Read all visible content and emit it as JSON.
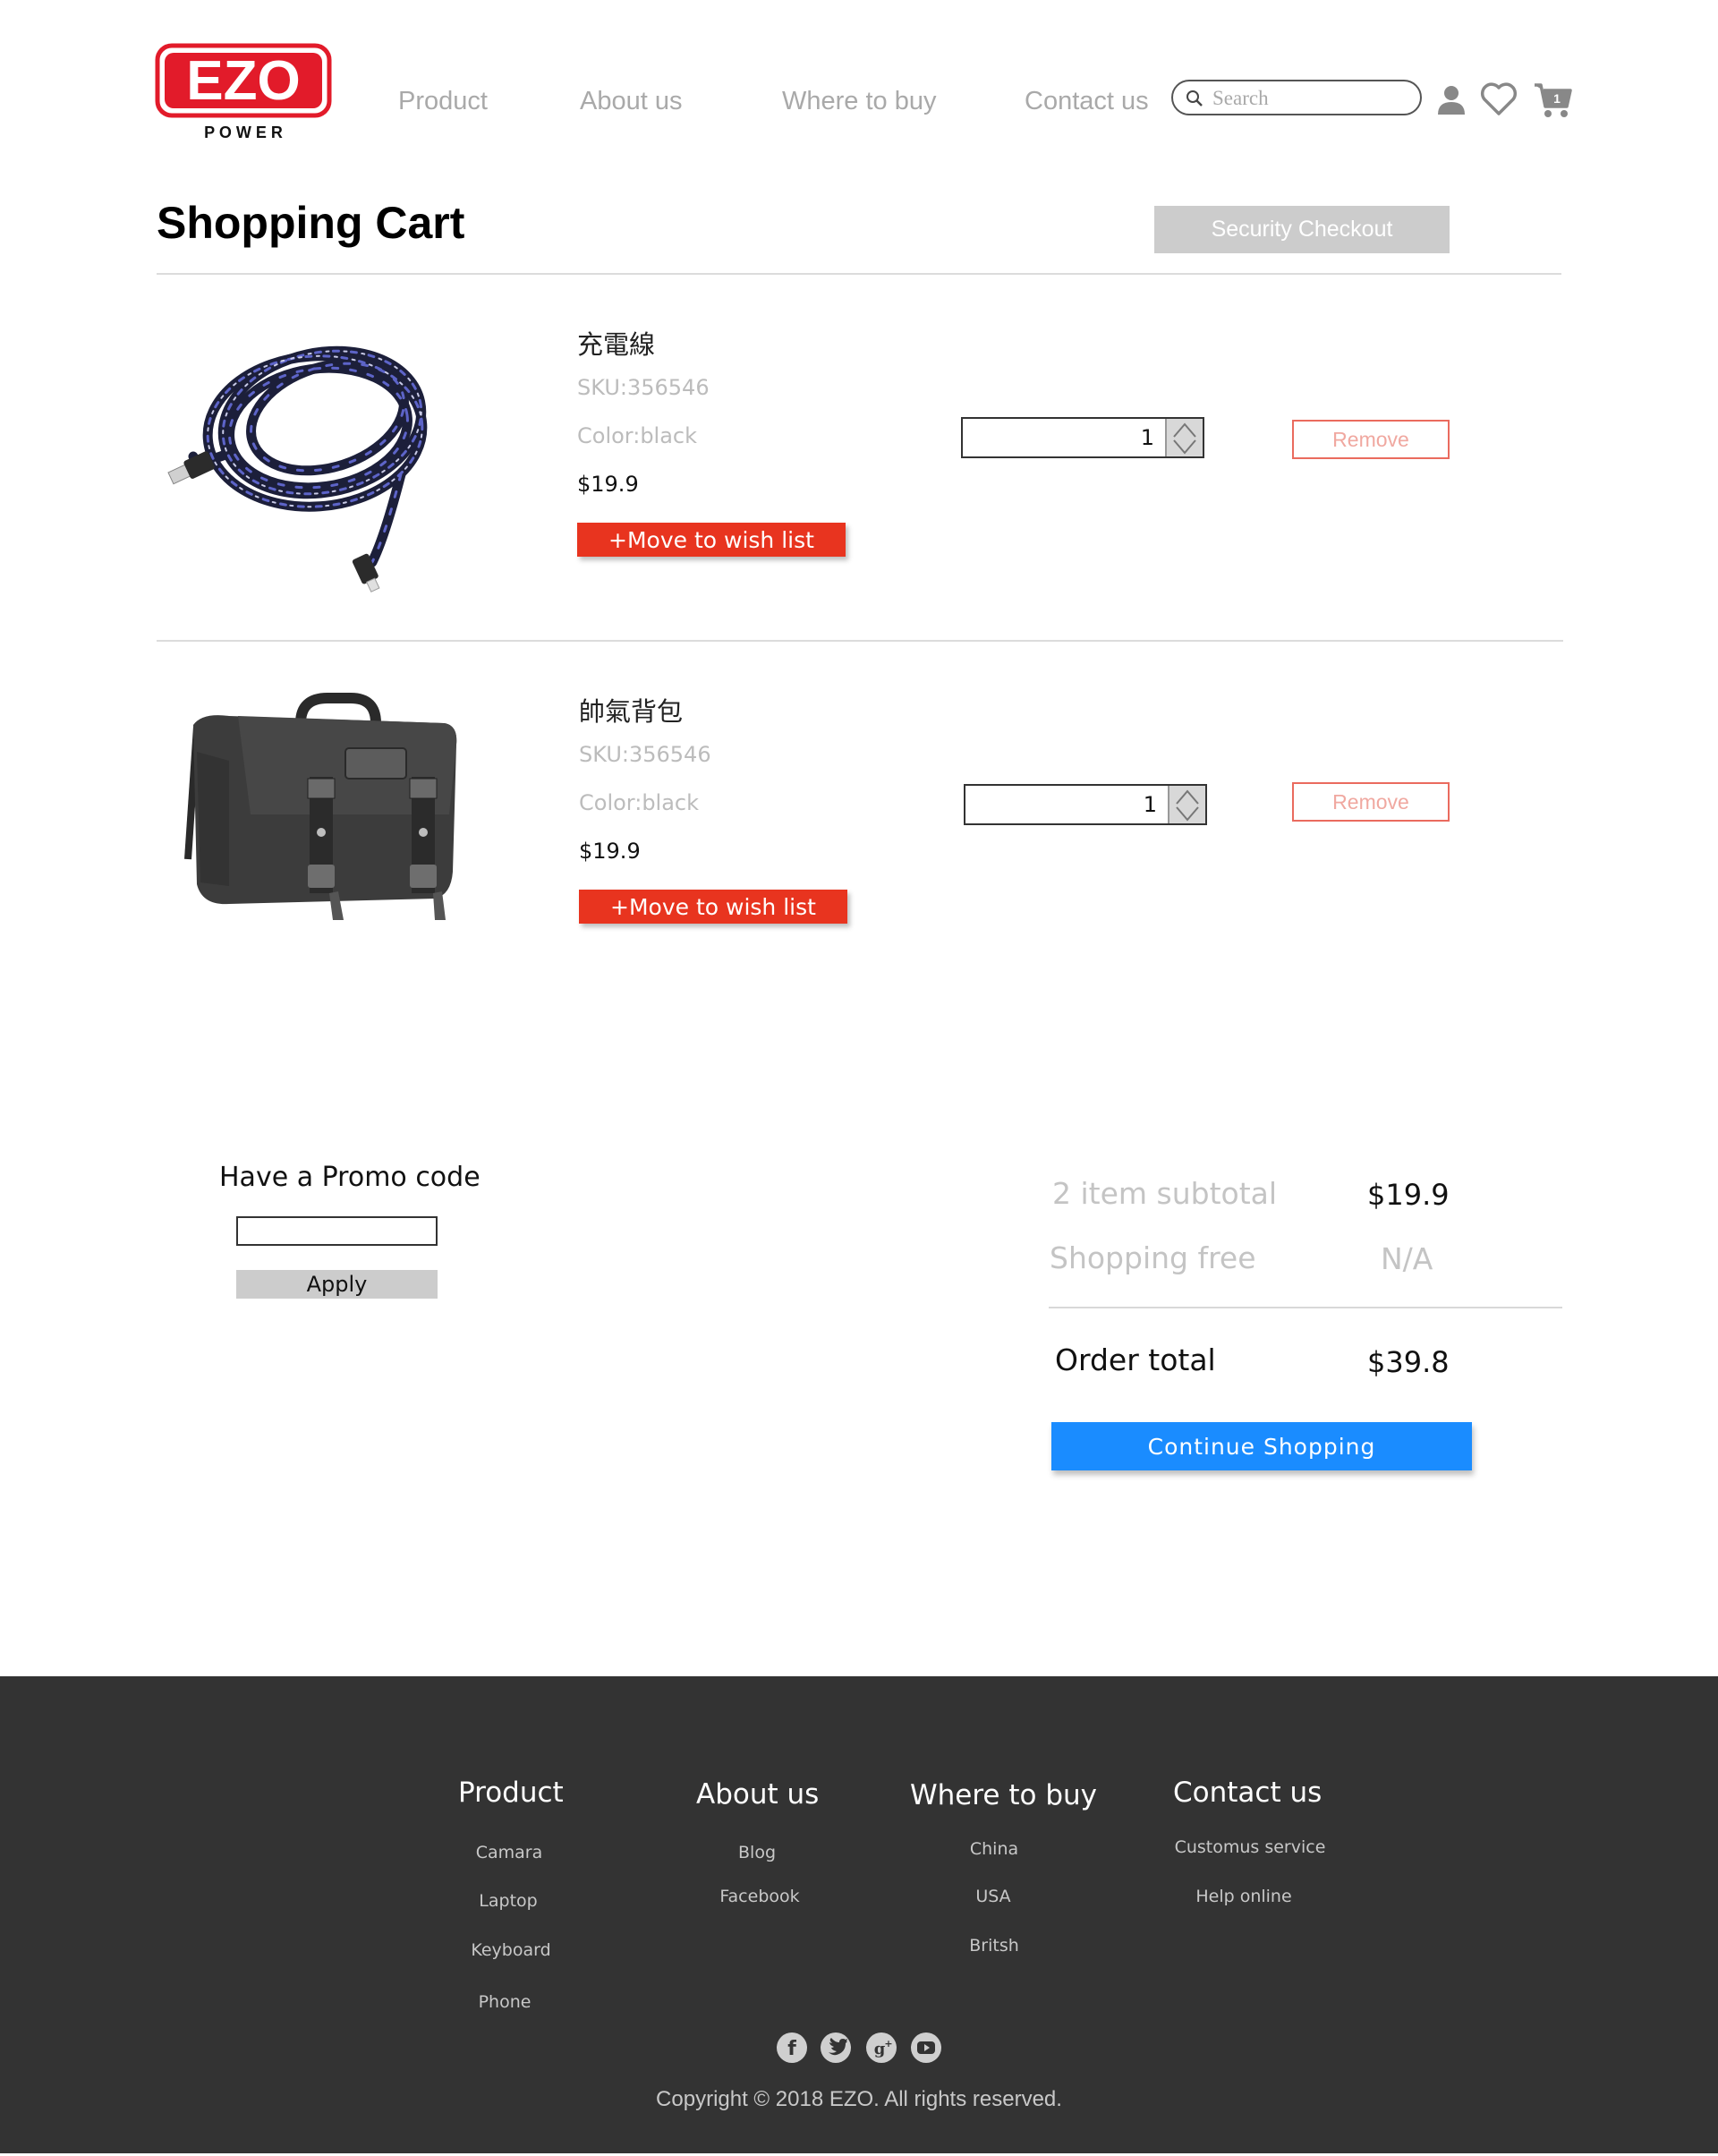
{
  "header": {
    "logo_text": "EZO",
    "logo_subtext": "P O W E R",
    "nav": [
      "Product",
      "About us",
      "Where to buy",
      "Contact us"
    ],
    "search_placeholder": "Search",
    "icons": [
      "user-icon",
      "heart-icon",
      "cart-icon"
    ],
    "cart_count": "1"
  },
  "cart": {
    "title": "Shopping Cart",
    "checkout_label": "Security Checkout",
    "items": [
      {
        "name": "充電線",
        "sku": "SKU:356546",
        "color": "Color:black",
        "price": "$19.9",
        "wish_label": "+Move to wish list",
        "quantity": "1",
        "remove_label": "Remove",
        "image": "braided-usb-cable"
      },
      {
        "name": "帥氣背包",
        "sku": "SKU:356546",
        "color": "Color:black",
        "price": "$19.9",
        "wish_label": "+Move to wish list",
        "quantity": "1",
        "remove_label": "Remove",
        "image": "black-messenger-bag"
      }
    ]
  },
  "promo": {
    "title": "Have a Promo code",
    "input_value": "",
    "apply_label": "Apply"
  },
  "summary": {
    "subtotal_label": "2 item subtotal",
    "subtotal_value": "$19.9",
    "shipping_label": "Shopping free",
    "shipping_value": "N/A",
    "total_label": "Order total",
    "total_value": "$39.8",
    "continue_label": "Continue Shopping"
  },
  "footer": {
    "columns": [
      {
        "title": "Product",
        "links": [
          "Camara",
          "Laptop",
          "Keyboard",
          "Phone"
        ]
      },
      {
        "title": "About us",
        "links": [
          "Blog",
          "Facebook"
        ]
      },
      {
        "title": "Where to buy",
        "links": [
          "China",
          "USA",
          "Britsh"
        ]
      },
      {
        "title": "Contact us",
        "links": [
          "Customus service",
          "Help online"
        ]
      }
    ],
    "social": [
      "facebook-icon",
      "twitter-icon",
      "google-plus-icon",
      "youtube-icon"
    ],
    "copyright": "Copyright © 2018 EZO. All rights reserved."
  },
  "colors": {
    "brand_red": "#e21b2a",
    "wish_button": "#e8341f",
    "continue_button": "#1a8cff",
    "footer_bg": "#333333"
  }
}
